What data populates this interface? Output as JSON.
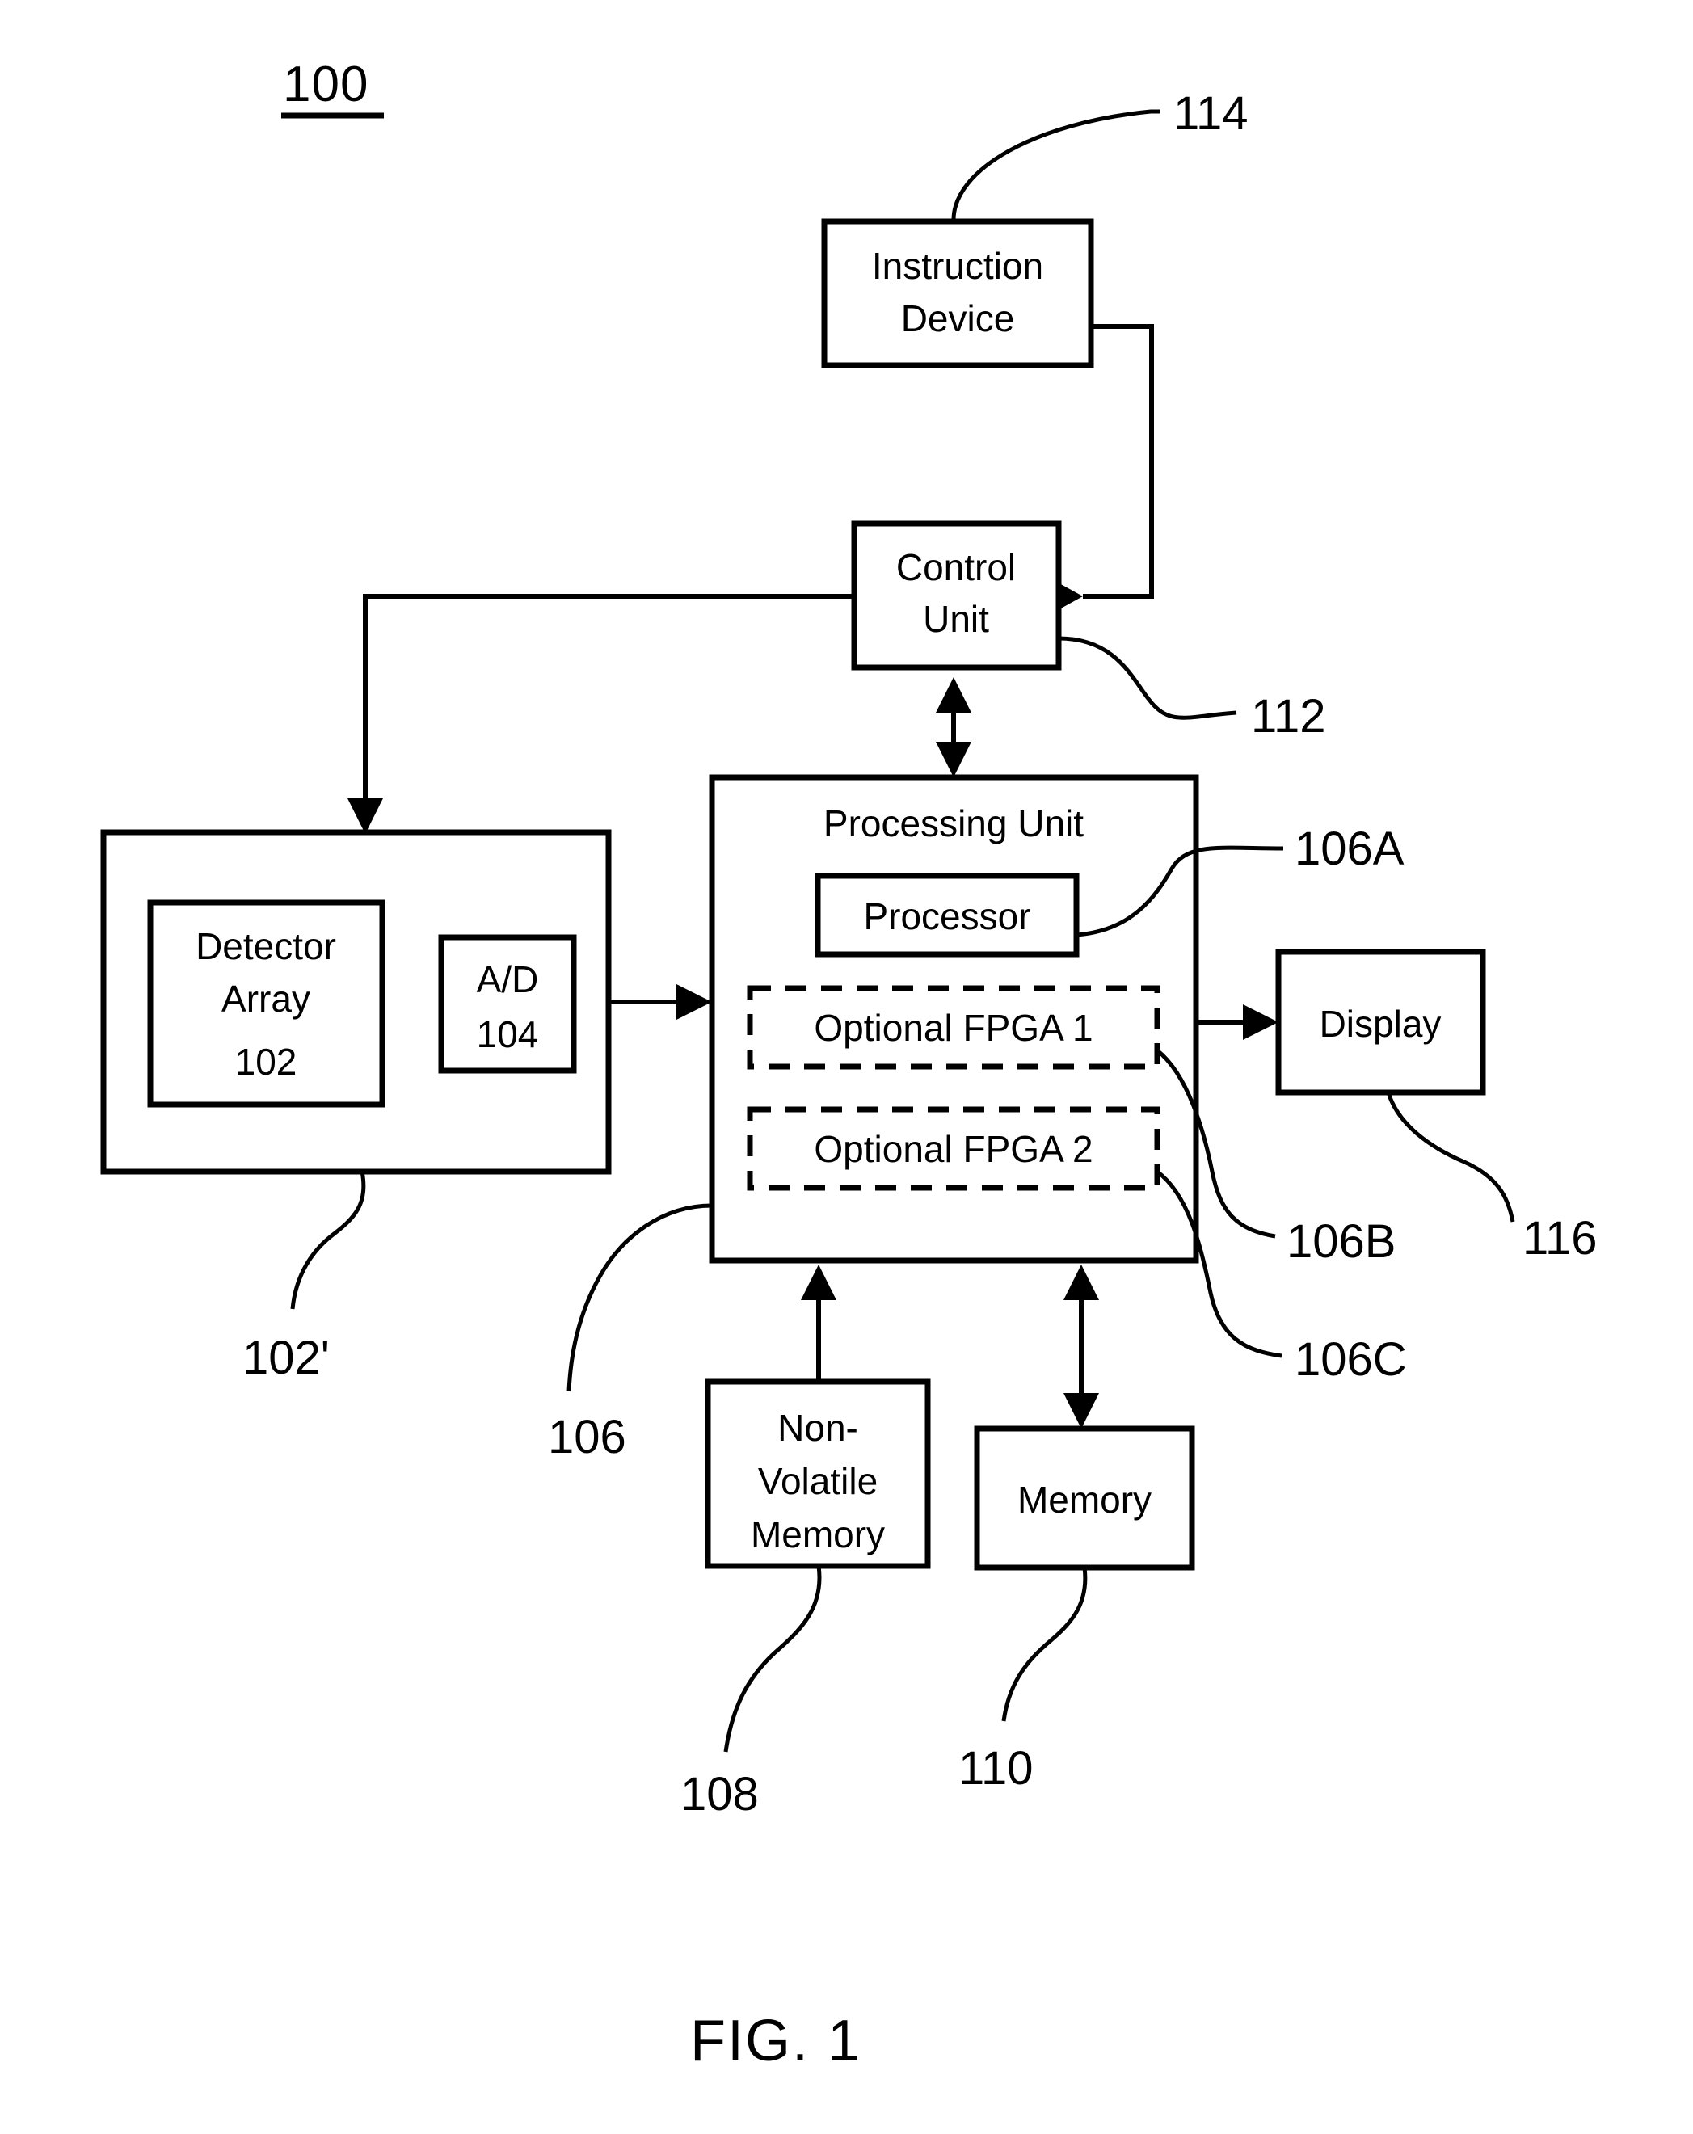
{
  "figure": {
    "number_label": "100",
    "caption": "FIG. 1"
  },
  "boxes": {
    "instruction_device": {
      "label_line1": "Instruction",
      "label_line2": "Device"
    },
    "control_unit": {
      "label_line1": "Control",
      "label_line2": "Unit"
    },
    "processing_unit": {
      "title": "Processing Unit"
    },
    "processor": {
      "label": "Processor"
    },
    "fpga1": {
      "label": "Optional FPGA 1"
    },
    "fpga2": {
      "label": "Optional FPGA 2"
    },
    "detector_array": {
      "label_line1": "Detector",
      "label_line2": "Array",
      "label_line3": "102"
    },
    "ad_converter": {
      "label_line1": "A/D",
      "label_line2": "104"
    },
    "display": {
      "label": "Display"
    },
    "non_volatile_memory": {
      "label_line1": "Non-",
      "label_line2": "Volatile",
      "label_line3": "Memory"
    },
    "memory": {
      "label": "Memory"
    }
  },
  "reference_numerals": {
    "n114": "114",
    "n112": "112",
    "n106A": "106A",
    "n106B": "106B",
    "n106C": "106C",
    "n116": "116",
    "n106": "106",
    "n102prime": "102'",
    "n108": "108",
    "n110": "110"
  },
  "colors": {
    "ink": "#000000",
    "paper": "#ffffff"
  }
}
